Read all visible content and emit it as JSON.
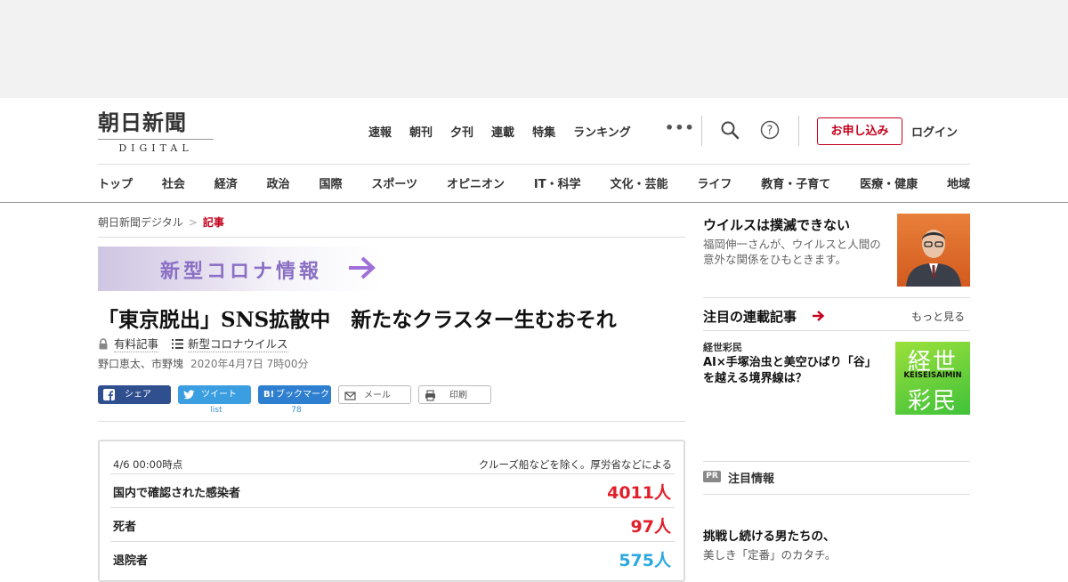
{
  "header": {
    "logo_main": "朝日新聞",
    "logo_sub": "DIGITAL",
    "topnav": [
      "速報",
      "朝刊",
      "夕刊",
      "連載",
      "特集",
      "ランキング"
    ],
    "more": "•••",
    "apply_label": "お申し込み",
    "login_label": "ログイン"
  },
  "categories": [
    "トップ",
    "社会",
    "経済",
    "政治",
    "国際",
    "スポーツ",
    "オピニオン",
    "IT・科学",
    "文化・芸能",
    "ライフ",
    "教育・子育て",
    "医療・健康",
    "地域"
  ],
  "breadcrumb": {
    "home": "朝日新聞デジタル",
    "sep": ">",
    "current": "記事"
  },
  "banner": {
    "text": "新型コロナ情報"
  },
  "article": {
    "title": "「東京脱出」SNS拡散中　新たなクラスター生むおそれ",
    "paid_label": "有料記事",
    "topic_label": "新型コロナウイルス",
    "authors": "野口恵太、市野塊",
    "date": "2020年4月7日 7時00分"
  },
  "share": {
    "facebook": "シェア",
    "twitter": "ツイート",
    "twitter_count": "list",
    "hatena": "ブックマーク",
    "hatena_count": "78",
    "mail": "メール",
    "print": "印刷"
  },
  "stats": {
    "as_of": "4/6 00:00時点",
    "note": "クルーズ船などを除く。厚労省などによる",
    "rows": [
      {
        "label": "国内で確認された感染者",
        "value": "4011人",
        "color": "#e0202a"
      },
      {
        "label": "死者",
        "value": "97人",
        "color": "#e0202a"
      },
      {
        "label": "退院者",
        "value": "575人",
        "color": "#2aa8e0"
      }
    ]
  },
  "sidebar": {
    "feature_title": "ウイルスは撲滅できない",
    "feature_text": "福岡伸一さんが、ウイルスと人間の意外な関係をひもときます。",
    "series_heading": "注目の連載記事",
    "more_label": "もっと見る",
    "series_tag": "経世彩民",
    "series_title": "AI×手塚治虫と美空ひばり「谷」を越える境界線は？",
    "series_img_top": "経世",
    "series_img_mid": "KEISEISAIMIN",
    "series_img_bot": "彩民",
    "pr_badge": "PR",
    "pr_heading": "注目情報",
    "pr_title": "挑戦し続ける男たちの、",
    "pr_text": "美しき「定番」のカタチ。"
  }
}
